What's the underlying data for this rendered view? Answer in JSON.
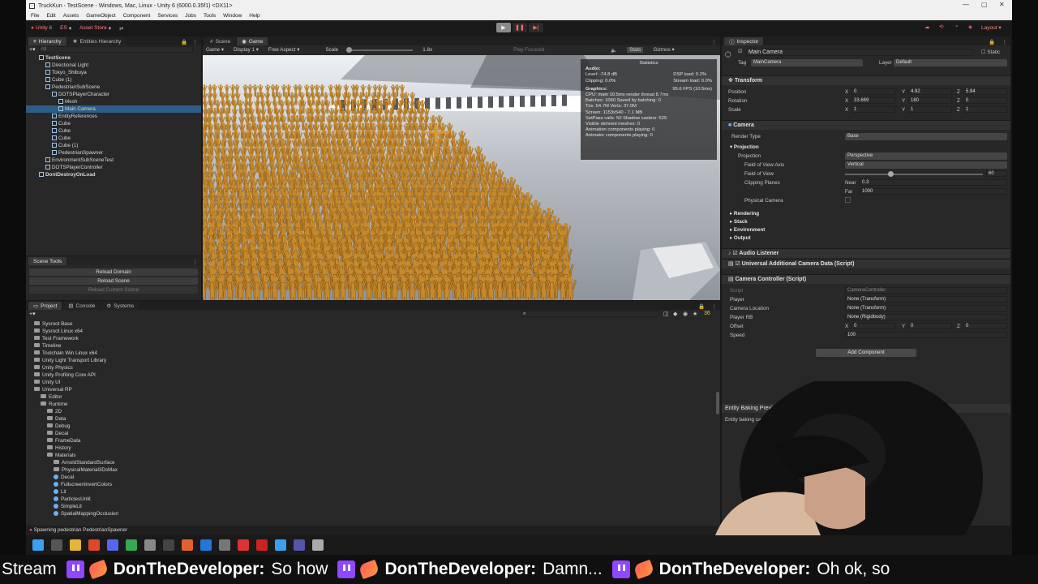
{
  "window": {
    "title": "TruckKun - TestScene - Windows, Mac, Linux - Unity 6 (6000.0.35f1) <DX11>",
    "controls": [
      "—",
      "▢",
      "✕"
    ]
  },
  "menu": [
    "File",
    "Edit",
    "Assets",
    "GameObject",
    "Component",
    "Services",
    "Jobs",
    "Tools",
    "Window",
    "Help"
  ],
  "toolbar": {
    "unity_label": "Unity 6",
    "es_label": "ES",
    "asset_store_label": "Asset Store",
    "layout_label": "Layout"
  },
  "hierarchy": {
    "tabs": [
      "Hierarchy",
      "Entities Hierarchy"
    ],
    "search_placeholder": "All",
    "items": [
      {
        "label": "TestScene",
        "depth": 0
      },
      {
        "label": "Directional Light",
        "depth": 1
      },
      {
        "label": "Tokyo_Shibuya",
        "depth": 1
      },
      {
        "label": "Cube (1)",
        "depth": 1
      },
      {
        "label": "PedestrianSubScene",
        "depth": 1
      },
      {
        "label": "DOTSPlayerCharacter",
        "depth": 2
      },
      {
        "label": "Mesh",
        "depth": 3
      },
      {
        "label": "Main Camera",
        "depth": 3
      },
      {
        "label": "EntityReferences",
        "depth": 2
      },
      {
        "label": "Cube",
        "depth": 2
      },
      {
        "label": "Cube",
        "depth": 2
      },
      {
        "label": "Cube",
        "depth": 2
      },
      {
        "label": "Cube (1)",
        "depth": 2
      },
      {
        "label": "PedestrianSpawner",
        "depth": 2
      },
      {
        "label": "EnvironmentSubSceneTest",
        "depth": 1
      },
      {
        "label": "DOTSPlayerController",
        "depth": 1
      },
      {
        "label": "DontDestroyOnLoad",
        "depth": 0
      }
    ]
  },
  "scene_tools": {
    "title": "Scene Tools",
    "buttons": [
      "Reload Domain",
      "Reload Scene",
      "Reload Current Scene"
    ]
  },
  "game_view": {
    "tabs": [
      "Scene",
      "Game"
    ],
    "game_dropdown": "Game",
    "display": "Display 1",
    "aspect": "Free Aspect",
    "scale_label": "Scale",
    "scale_value": "1.8x",
    "play_focused": "Play Focused",
    "stats_label": "Stats",
    "gizmos_label": "Gizmos"
  },
  "statistics": {
    "title": "Statistics",
    "audio_head": "Audio:",
    "audio_left": [
      "Level: -74.8 dB",
      "Clipping: 0.0%"
    ],
    "audio_right": [
      "DSP load: 0.2%",
      "Stream load: 0.0%"
    ],
    "graphics_head": "Graphics:",
    "fps": "95.6 FPS (10.5ms)",
    "lines": [
      "CPU: main 10.5ms  render thread 8.7ms",
      "Batches: 1060   Saved by batching: 0",
      "Tris: 54.7M      Verts: 37.0M",
      "Screen: 1153x540 - 7.1 MB",
      "SetPass calls: 50     Shadow casters: 625",
      "Visible skinned meshes: 0",
      "Animation components playing: 0",
      "Animator components playing: 0"
    ]
  },
  "project": {
    "tabs": [
      "Project",
      "Console",
      "Systems"
    ],
    "items": [
      {
        "label": "Sysroot Base",
        "depth": 0,
        "type": "folder"
      },
      {
        "label": "Sysroot Linux x64",
        "depth": 0,
        "type": "folder"
      },
      {
        "label": "Test Framework",
        "depth": 0,
        "type": "folder"
      },
      {
        "label": "Timeline",
        "depth": 0,
        "type": "folder"
      },
      {
        "label": "Toolchain Win Linux x64",
        "depth": 0,
        "type": "folder"
      },
      {
        "label": "Unity Light Transport Library",
        "depth": 0,
        "type": "folder"
      },
      {
        "label": "Unity Physics",
        "depth": 0,
        "type": "folder"
      },
      {
        "label": "Unity Profiling Core API",
        "depth": 0,
        "type": "folder"
      },
      {
        "label": "Unity UI",
        "depth": 0,
        "type": "folder"
      },
      {
        "label": "Universal RP",
        "depth": 0,
        "type": "folder"
      },
      {
        "label": "Editor",
        "depth": 1,
        "type": "folder"
      },
      {
        "label": "Runtime",
        "depth": 1,
        "type": "folder"
      },
      {
        "label": "2D",
        "depth": 2,
        "type": "folder"
      },
      {
        "label": "Data",
        "depth": 2,
        "type": "folder"
      },
      {
        "label": "Debug",
        "depth": 2,
        "type": "folder"
      },
      {
        "label": "Decal",
        "depth": 2,
        "type": "folder"
      },
      {
        "label": "FrameData",
        "depth": 2,
        "type": "folder"
      },
      {
        "label": "History",
        "depth": 2,
        "type": "folder"
      },
      {
        "label": "Materials",
        "depth": 2,
        "type": "folder"
      },
      {
        "label": "ArnoldStandardSurface",
        "depth": 3,
        "type": "folder"
      },
      {
        "label": "PhysicalMaterial3DsMax",
        "depth": 3,
        "type": "folder"
      },
      {
        "label": "Decal",
        "depth": 3,
        "type": "asset"
      },
      {
        "label": "FullscreenInvertColors",
        "depth": 3,
        "type": "asset"
      },
      {
        "label": "Lit",
        "depth": 3,
        "type": "asset"
      },
      {
        "label": "ParticlesUnlit",
        "depth": 3,
        "type": "asset"
      },
      {
        "label": "SimpleLit",
        "depth": 3,
        "type": "asset"
      },
      {
        "label": "SpatialMappingOcclusion",
        "depth": 3,
        "type": "asset"
      }
    ]
  },
  "status_bar": "Spawning pedestrian PedestrianSpawner",
  "inspector": {
    "tab": "Inspector",
    "object_name": "Main Camera",
    "static_label": "Static",
    "tag_label": "Tag",
    "tag_value": "MainCamera",
    "layer_label": "Layer",
    "layer_value": "Default",
    "transform": {
      "title": "Transform",
      "position_label": "Position",
      "position": [
        "0",
        "4.92",
        "5.94"
      ],
      "rotation_label": "Rotation",
      "rotation": [
        "33.669",
        "180",
        "0"
      ],
      "scale_label": "Scale",
      "scale": [
        "1",
        "1",
        "1"
      ]
    },
    "camera": {
      "title": "Camera",
      "render_type_label": "Render Type",
      "render_type": "Base",
      "projection_head": "Projection",
      "projection_label": "Projection",
      "projection": "Perspective",
      "fov_axis_label": "Field of View Axis",
      "fov_axis": "Vertical",
      "fov_label": "Field of View",
      "fov": "60",
      "fov_fraction": 0.33,
      "clipping_label": "Clipping Planes",
      "near_label": "Near",
      "near": "0.3",
      "far_label": "Far",
      "far": "1000",
      "physical_label": "Physical Camera",
      "sections": [
        "Rendering",
        "Stack",
        "Environment",
        "Output"
      ]
    },
    "audio_listener": "Audio Listener",
    "urp_camera_data": "Universal Additional Camera Data (Script)",
    "camera_controller": {
      "title": "Camera Controller (Script)",
      "script_label": "Script",
      "script_value": "CameraController",
      "player_label": "Player",
      "player_value": "None (Transform)",
      "location_label": "Camera Location",
      "location_value": "None (Transform)",
      "player_rb_label": "Player RB",
      "player_rb_value": "None (Rigidbody)",
      "offset_label": "Offset",
      "offset": [
        "0",
        "0",
        "0"
      ],
      "speed_label": "Speed",
      "speed_value": "100"
    },
    "add_component": "Add Component",
    "baking_title": "Entity Baking Preview",
    "baking_text": "Entity baking can only be previewed for GameObjects baked"
  },
  "ticker": [
    {
      "prefix": "Stream",
      "user": "",
      "msg": ""
    },
    {
      "user": "DonTheDeveloper:",
      "msg": "So how"
    },
    {
      "user": "DonTheDeveloper:",
      "msg": "Damn..."
    },
    {
      "user": "DonTheDeveloper:",
      "msg": "Oh ok, so"
    }
  ],
  "colors": {
    "accent_selection": "#2c5d87",
    "twitch": "#9146ff",
    "mannequin": "#c68a2c",
    "editor_bg": "#282828"
  }
}
